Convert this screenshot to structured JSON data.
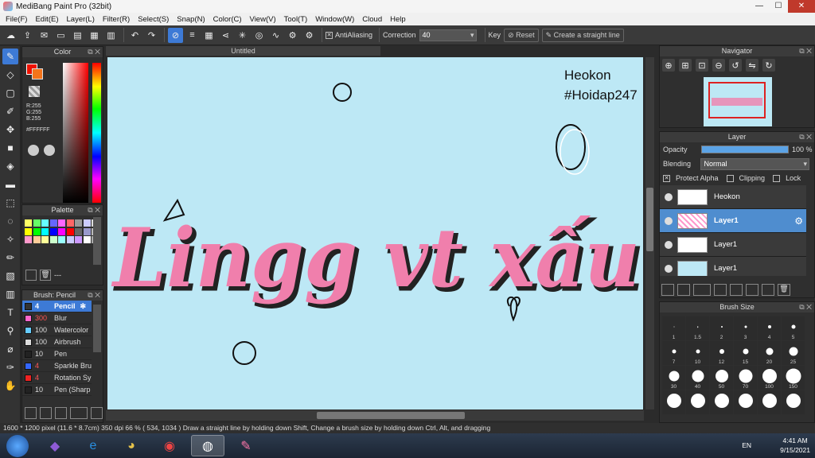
{
  "window": {
    "title": "MediBang Paint Pro (32bit)"
  },
  "menu": [
    "File(F)",
    "Edit(E)",
    "Layer(L)",
    "Filter(R)",
    "Select(S)",
    "Snap(N)",
    "Color(C)",
    "View(V)",
    "Tool(T)",
    "Window(W)",
    "Cloud",
    "Help"
  ],
  "toolbar": {
    "antialiasing_label": "AntiAliasing",
    "correction_label": "Correction",
    "correction_value": "40",
    "key_label": "Key",
    "reset_label": "Reset",
    "straight_line_label": "Create a straight line"
  },
  "color_panel": {
    "title": "Color",
    "r": "R:255",
    "g": "G:255",
    "b": "B:255",
    "hex": "#FFFFFF",
    "primary": "#ee1100",
    "secondary": "#f5741a"
  },
  "palette_panel": {
    "title": "Palette",
    "dash": "---",
    "colors": [
      "#ffff66",
      "#66ff66",
      "#66ffff",
      "#6666ff",
      "#ff66ff",
      "#ff6666",
      "#999999",
      "#ccccff",
      "#dddddd",
      "#ffff00",
      "#00ff00",
      "#00ffff",
      "#0000ff",
      "#ff00ff",
      "#ff0000",
      "#666666",
      "#9999cc",
      "#bbbbbb",
      "#ff99cc",
      "#ffcc99",
      "#ffff99",
      "#ccffcc",
      "#99ffff",
      "#ccccff",
      "#cc99ff",
      "#ffffff",
      "#aaaaaa"
    ]
  },
  "brush_panel": {
    "title": "Brush: Pencil",
    "items": [
      {
        "size": "4",
        "name": "Pencil",
        "color": "#333333",
        "selected": true
      },
      {
        "size": "300",
        "name": "Blur",
        "color": "#ff66cc",
        "selected": false
      },
      {
        "size": "100",
        "name": "Watercolor",
        "color": "#66ccff",
        "selected": false
      },
      {
        "size": "100",
        "name": "Airbrush",
        "color": "#dddddd",
        "selected": false
      },
      {
        "size": "10",
        "name": "Pen",
        "color": "#222222",
        "selected": false
      },
      {
        "size": "4",
        "name": "Sparkle Bru",
        "color": "#3366ff",
        "selected": false
      },
      {
        "size": "4",
        "name": "Rotation Sy",
        "color": "#ee2222",
        "selected": false
      },
      {
        "size": "10",
        "name": "Pen (Sharp",
        "color": "#222222",
        "selected": false
      }
    ]
  },
  "document": {
    "tab": "Untitled"
  },
  "canvas_text": {
    "line1": "Heokon",
    "line2": "#Hoidap247",
    "lettering": "Lingg vt xấu"
  },
  "navigator": {
    "title": "Navigator"
  },
  "layer_panel": {
    "title": "Layer",
    "opacity_label": "Opacity",
    "opacity_value": "100 %",
    "opacity_percent": 100,
    "blending_label": "Blending",
    "blending_value": "Normal",
    "protect_alpha": "Protect Alpha",
    "clipping": "Clipping",
    "lock": "Lock",
    "layers": [
      {
        "name": "Heokon",
        "selected": false
      },
      {
        "name": "Layer1",
        "selected": true
      },
      {
        "name": "Layer1",
        "selected": false
      },
      {
        "name": "Layer1",
        "selected": false
      }
    ]
  },
  "brush_size_panel": {
    "title": "Brush Size",
    "sizes": [
      "1",
      "1.5",
      "2",
      "3",
      "4",
      "5",
      "7",
      "10",
      "12",
      "15",
      "20",
      "25",
      "30",
      "40",
      "50",
      "70",
      "100",
      "150",
      "",
      "",
      "",
      "",
      "",
      ""
    ]
  },
  "status": {
    "text": "1600 * 1200 pixel   (11.6 * 8.7cm)   350 dpi   66 %   ( 534, 1034 )   Draw a straight line by holding down Shift, Change a brush size by holding down Ctrl, Alt, and dragging"
  },
  "taskbar": {
    "lang": "EN",
    "time": "4:41 AM",
    "date": "9/15/2021"
  }
}
